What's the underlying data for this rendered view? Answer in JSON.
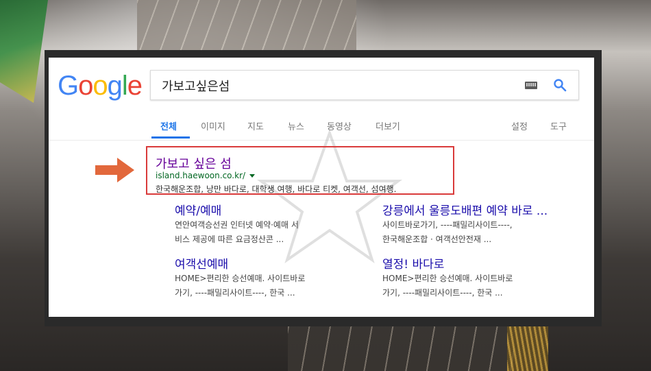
{
  "search": {
    "query": "가보고싶은섬",
    "logo_letters": [
      {
        "char": "G",
        "color": "#4285F4"
      },
      {
        "char": "o",
        "color": "#EA4335"
      },
      {
        "char": "o",
        "color": "#FBBC05"
      },
      {
        "char": "g",
        "color": "#4285F4"
      },
      {
        "char": "l",
        "color": "#34A853"
      },
      {
        "char": "e",
        "color": "#EA4335"
      }
    ]
  },
  "tabs": [
    "전체",
    "이미지",
    "지도",
    "뉴스",
    "동영상",
    "더보기"
  ],
  "tools": {
    "settings": "설정",
    "tools": "도구"
  },
  "result": {
    "title": "가보고 싶은 섬",
    "url": "island.haewoon.co.kr/",
    "snippet": "한국해운조합, 낭만 바다로, 대학생 여행, 바다로 티켓, 여객선, 섬여행."
  },
  "sitelinks": [
    {
      "title": "예약/예매",
      "lines": [
        "연안여객승선권 인터넷 예약·예매 서",
        "비스 제공에 따른 요금정산콘 ..."
      ]
    },
    {
      "title": "강릉에서 울릉도배편 예약 바로 ...",
      "lines": [
        "사이트바로가기, ----패밀리사이트----,",
        "한국해운조합 · 여객선안전재 ..."
      ]
    },
    {
      "title": "여객선예매",
      "lines": [
        "HOME>편리한 승선예매. 사이트바로",
        "가기, ----패밀리사이트----, 한국 ..."
      ]
    },
    {
      "title": "열정! 바다로",
      "lines": [
        "HOME>편리한 승선예매. 사이트바로",
        "가기, ----패밀리사이트----, 한국 ..."
      ]
    }
  ],
  "colors": {
    "accent": "#1a73e8",
    "link": "#1a0dab",
    "visited": "#660099",
    "url": "#006621",
    "highlight": "#d93a3a",
    "arrow": "#e2683c"
  },
  "icons": [
    "keyboard-icon",
    "search-icon",
    "arrow-right-icon",
    "star-watermark-icon"
  ]
}
